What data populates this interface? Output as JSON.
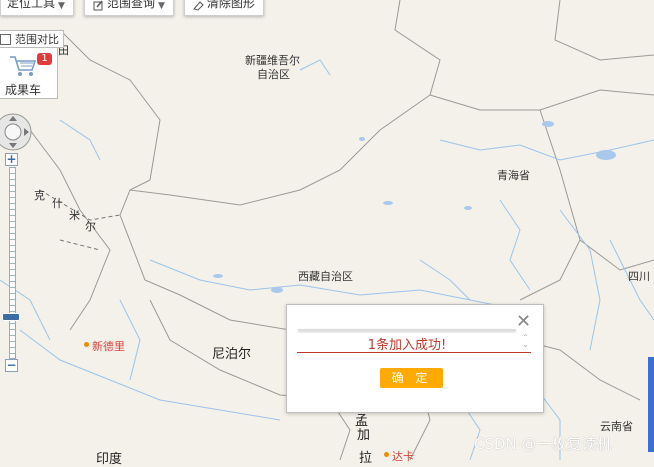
{
  "toolbar": {
    "locate_tool": "定位工具",
    "range_query": "范围查询",
    "clear_graphics": "清除图形"
  },
  "range_compare": {
    "label": "范围对比",
    "checked": false
  },
  "cart": {
    "label": "成果车",
    "badge": "1"
  },
  "map_labels": {
    "xinjiang_1": "新疆维吾尔",
    "xinjiang_2": "自治区",
    "qinghai": "青海省",
    "tibet": "西藏自治区",
    "sichuan": "四川",
    "nepal": "尼泊尔",
    "new_delhi": "新德里",
    "india": "印度",
    "yunnan": "云南省",
    "kashmir_1": "克",
    "kashmir_2": "什",
    "kashmir_3": "米",
    "kashmir_4": "尔",
    "bangla_1": "孟",
    "bangla_2": "加",
    "bangla_3": "拉",
    "dhaka": "达卡",
    "partial_top": "田"
  },
  "dialog": {
    "message": "1条加入成功!",
    "confirm": "确 定"
  },
  "watermark": "CSDN @一枚复读机",
  "colors": {
    "map_bg": "#f4f1ea",
    "river": "#9cc3ea",
    "border": "#8a8a8a",
    "accent": "#ffaa00",
    "error_red": "#c0392b"
  }
}
